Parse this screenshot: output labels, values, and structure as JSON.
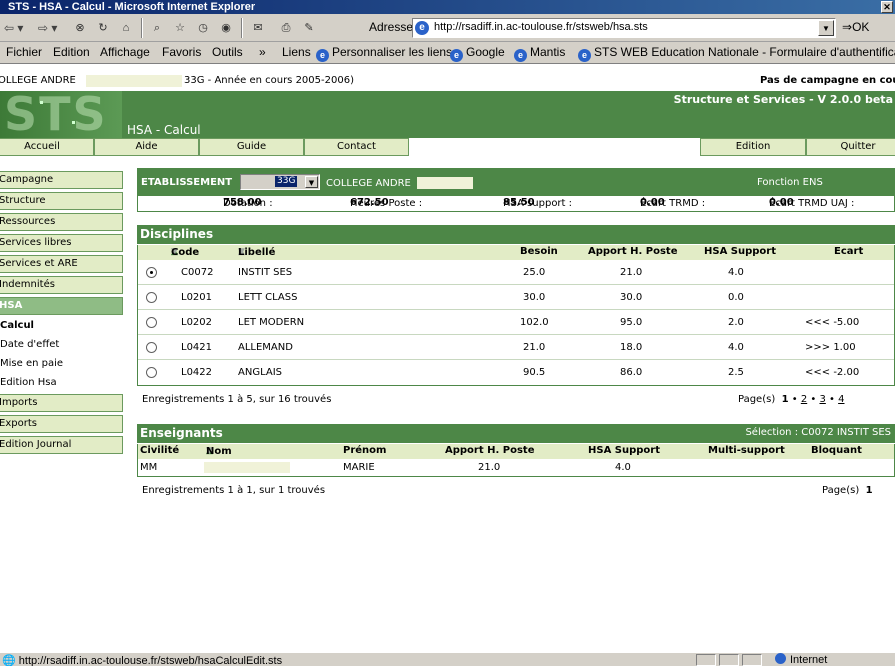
{
  "browser": {
    "title": "STS - HSA - Calcul - Microsoft Internet Explorer",
    "address_label": "Adresse",
    "url": "http://rsadiff.in.ac-toulouse.fr/stsweb/hsa.sts",
    "go_label": "OK",
    "menu": [
      "Fichier",
      "Edition",
      "Affichage",
      "Favoris",
      "Outils"
    ],
    "menu_more": "»",
    "links_label": "Liens",
    "links": [
      "Personnaliser les liens",
      "Google",
      "Mantis",
      "STS WEB Education Nationale - Formulaire d'authentification"
    ],
    "status_url": "http://rsadiff.in.ac-toulouse.fr/stsweb/hsaCalculEdit.sts",
    "status_zone": "Internet"
  },
  "header": {
    "college_prefix": "OLLEGE ANDRE",
    "college_suffix": "33G - Année en cours 2005-2006)",
    "campaign_notice": "Pas de campagne en cou",
    "logo_text": "STS",
    "app_name": "Structure et Services - V 2.0.0 beta",
    "page_title": "HSA - Calcul"
  },
  "nav": {
    "left": [
      "Accueil",
      "Aide",
      "Guide",
      "Contact"
    ],
    "right": [
      "Edition",
      "Quitter"
    ]
  },
  "sidebar": {
    "items": [
      {
        "label": "Campagne"
      },
      {
        "label": "Structure"
      },
      {
        "label": "Ressources"
      },
      {
        "label": "Services libres"
      },
      {
        "label": "Services et ARE"
      },
      {
        "label": "Indemnités"
      },
      {
        "label": "HSA"
      }
    ],
    "sub_items": [
      "Calcul",
      "Date d'effet",
      "Mise en paie",
      "Edition Hsa"
    ],
    "bottom_items": [
      "Imports",
      "Exports",
      "Edition Journal"
    ]
  },
  "etablissement": {
    "label": "ETABLISSEMENT",
    "selected_code": "33G",
    "college_name": "COLLEGE ANDRE",
    "fonction": "Fonction ENS"
  },
  "stats": {
    "dotation_label": "Dotation :",
    "dotation": "758.00",
    "heures_poste_label": "Heures Poste :",
    "heures_poste": "672.50",
    "hsa_support_label": "HSA support :",
    "hsa_support": "85.50",
    "ecart_trmd_label": "Écart TRMD :",
    "ecart_trmd": "0.00",
    "ecart_trmd_uaj_label": "Écart TRMD UAJ :",
    "ecart_trmd_uaj": "0.00"
  },
  "disciplines": {
    "title": "Disciplines",
    "columns": {
      "code": "Code",
      "libelle": "Libellé",
      "besoin": "Besoin",
      "apport": "Apport H. Poste",
      "hsa": "HSA Support",
      "ecart": "Ecart"
    },
    "rows": [
      {
        "selected": true,
        "code": "C0072",
        "libelle": "INSTIT SES",
        "besoin": "25.0",
        "apport": "21.0",
        "hsa": "4.0",
        "ecart": ""
      },
      {
        "selected": false,
        "code": "L0201",
        "libelle": "LETT CLASS",
        "besoin": "30.0",
        "apport": "30.0",
        "hsa": "0.0",
        "ecart": ""
      },
      {
        "selected": false,
        "code": "L0202",
        "libelle": "LET MODERN",
        "besoin": "102.0",
        "apport": "95.0",
        "hsa": "2.0",
        "ecart": "<<< -5.00"
      },
      {
        "selected": false,
        "code": "L0421",
        "libelle": "ALLEMAND",
        "besoin": "21.0",
        "apport": "18.0",
        "hsa": "4.0",
        "ecart": ">>> 1.00"
      },
      {
        "selected": false,
        "code": "L0422",
        "libelle": "ANGLAIS",
        "besoin": "90.5",
        "apport": "86.0",
        "hsa": "2.5",
        "ecart": "<<< -2.00"
      }
    ],
    "records": "Enregistrements 1 à 5, sur 16 trouvés",
    "pages_label": "Page(s)",
    "current_page": "1",
    "other_pages": [
      "2",
      "3",
      "4"
    ]
  },
  "enseignants": {
    "title": "Enseignants",
    "selection": "Sélection : C0072 INSTIT SES",
    "columns": {
      "civilite": "Civilité",
      "nom": "Nom",
      "prenom": "Prénom",
      "apport": "Apport H. Poste",
      "hsa": "HSA Support",
      "multi": "Multi-support",
      "bloquant": "Bloquant"
    },
    "rows": [
      {
        "civilite": "MM",
        "prenom": "MARIE",
        "apport": "21.0",
        "hsa": "4.0"
      }
    ],
    "records": "Enregistrements 1 à 1, sur 1 trouvés",
    "pages_label": "Page(s)",
    "current_page": "1"
  },
  "colors": {
    "banner_green": "#4d8747",
    "tab_fill": "#e2ecc6",
    "active_item": "#8fbc85",
    "masked_field": "#f0f2d8"
  }
}
